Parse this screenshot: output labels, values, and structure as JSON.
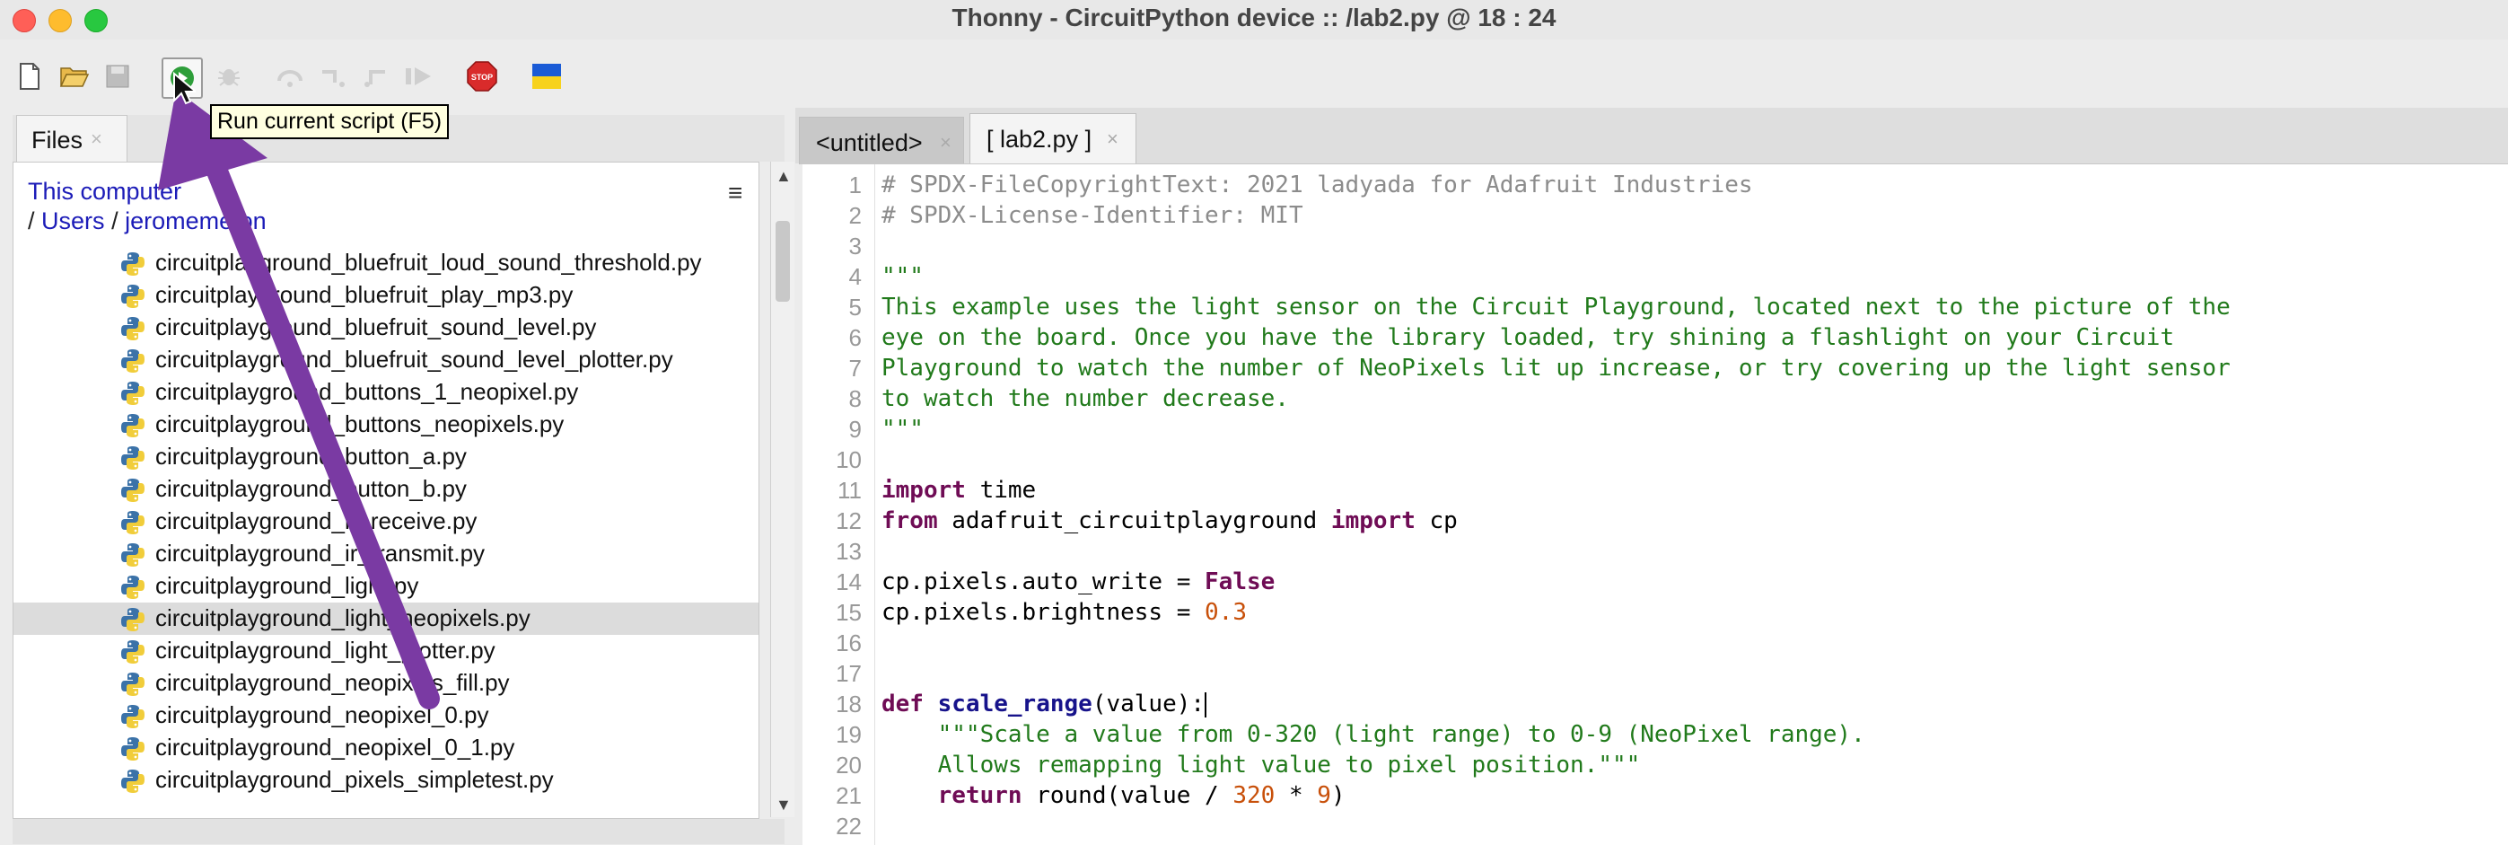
{
  "window": {
    "title": "Thonny  -  CircuitPython device :: /lab2.py  @  18 : 24"
  },
  "toolbar": {
    "buttons": [
      "new-file",
      "open-file",
      "save-file",
      "run-current-script",
      "debug",
      "step-over",
      "step-into",
      "step-out",
      "resume",
      "stop",
      "ukraine-flag"
    ],
    "stop_label": "STOP",
    "tooltip": "Run current script (F5)"
  },
  "files": {
    "tab_label": "Files",
    "tab_close": "×",
    "location_label": "This computer",
    "path": {
      "sep1": "/",
      "users": "Users",
      "sep2": "/",
      "user": "jeromemeton"
    },
    "menu_glyph": "≡",
    "items": [
      "circuitplayground_bluefruit_loud_sound_threshold.py",
      "circuitplayground_bluefruit_play_mp3.py",
      "circuitplayground_bluefruit_sound_level.py",
      "circuitplayground_bluefruit_sound_level_plotter.py",
      "circuitplayground_buttons_1_neopixel.py",
      "circuitplayground_buttons_neopixels.py",
      "circuitplayground_button_a.py",
      "circuitplayground_button_b.py",
      "circuitplayground_ir_receive.py",
      "circuitplayground_ir_transmit.py",
      "circuitplayground_light.py",
      "circuitplayground_light_neopixels.py",
      "circuitplayground_light_plotter.py",
      "circuitplayground_neopixels_fill.py",
      "circuitplayground_neopixel_0.py",
      "circuitplayground_neopixel_0_1.py",
      "circuitplayground_pixels_simpletest.py"
    ],
    "selected_index": 11
  },
  "editor": {
    "tabs": [
      {
        "label": "<untitled>",
        "close": "×"
      },
      {
        "label": "[ lab2.py ]",
        "close": "×"
      }
    ],
    "active_tab": 1,
    "line_numbers": [
      "1",
      "2",
      "3",
      "4",
      "5",
      "6",
      "7",
      "8",
      "9",
      "10",
      "11",
      "12",
      "13",
      "14",
      "15",
      "16",
      "17",
      "18",
      "19",
      "20",
      "21",
      "22"
    ],
    "code": {
      "l1": "# SPDX-FileCopyrightText: 2021 ladyada for Adafruit Industries",
      "l2": "# SPDX-License-Identifier: MIT",
      "l4": "\"\"\"",
      "l5": "This example uses the light sensor on the Circuit Playground, located next to the picture of the",
      "l6": "eye on the board. Once you have the library loaded, try shining a flashlight on your Circuit",
      "l7": "Playground to watch the number of NeoPixels lit up increase, or try covering up the light sensor",
      "l8": "to watch the number decrease.",
      "l9": "\"\"\"",
      "l11_kw": "import",
      "l11_rest": " time",
      "l12_kw1": "from",
      "l12_mid": " adafruit_circuitplayground ",
      "l12_kw2": "import",
      "l12_rest": " cp",
      "l14_a": "cp.pixels.auto_write = ",
      "l14_kw": "False",
      "l15_a": "cp.pixels.brightness = ",
      "l15_num": "0.3",
      "l18_kw": "def",
      "l18_fn": "scale_range",
      "l18_rest": "(value):",
      "l19": "    \"\"\"Scale a value from 0-320 (light range) to 0-9 (NeoPixel range).",
      "l20": "    Allows remapping light value to pixel position.\"\"\"",
      "l21_indent": "    ",
      "l21_kw": "return",
      "l21_a": " round(value / ",
      "l21_n1": "320",
      "l21_b": " * ",
      "l21_n2": "9",
      "l21_c": ")"
    }
  },
  "colors": {
    "comment": "#8c8c8c",
    "string": "#217a1b",
    "keyword": "#6f0c55",
    "number": "#c8500a",
    "function_name": "#17138b",
    "annotation_arrow": "#7a3aa3"
  }
}
